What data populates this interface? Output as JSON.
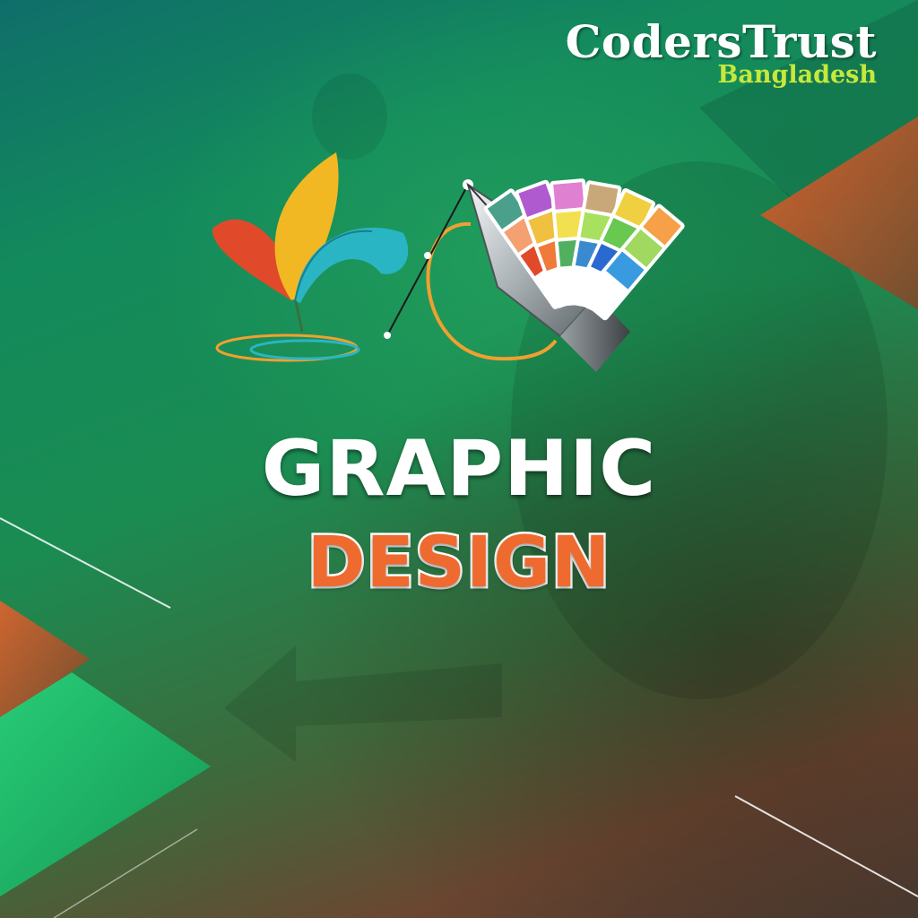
{
  "brand": {
    "name": "CodersTrust",
    "region": "Bangladesh"
  },
  "headline": {
    "line1": "GRAPHIC",
    "line2": "DESIGN"
  },
  "icons": [
    "feather-icon",
    "pen-tool-icon",
    "color-swatch-fan-icon"
  ],
  "colors": {
    "background_green": "#1a8c52",
    "accent_orange": "#ee6a2e",
    "logo_sub": "#c6e83c",
    "title_white": "#ffffff"
  }
}
